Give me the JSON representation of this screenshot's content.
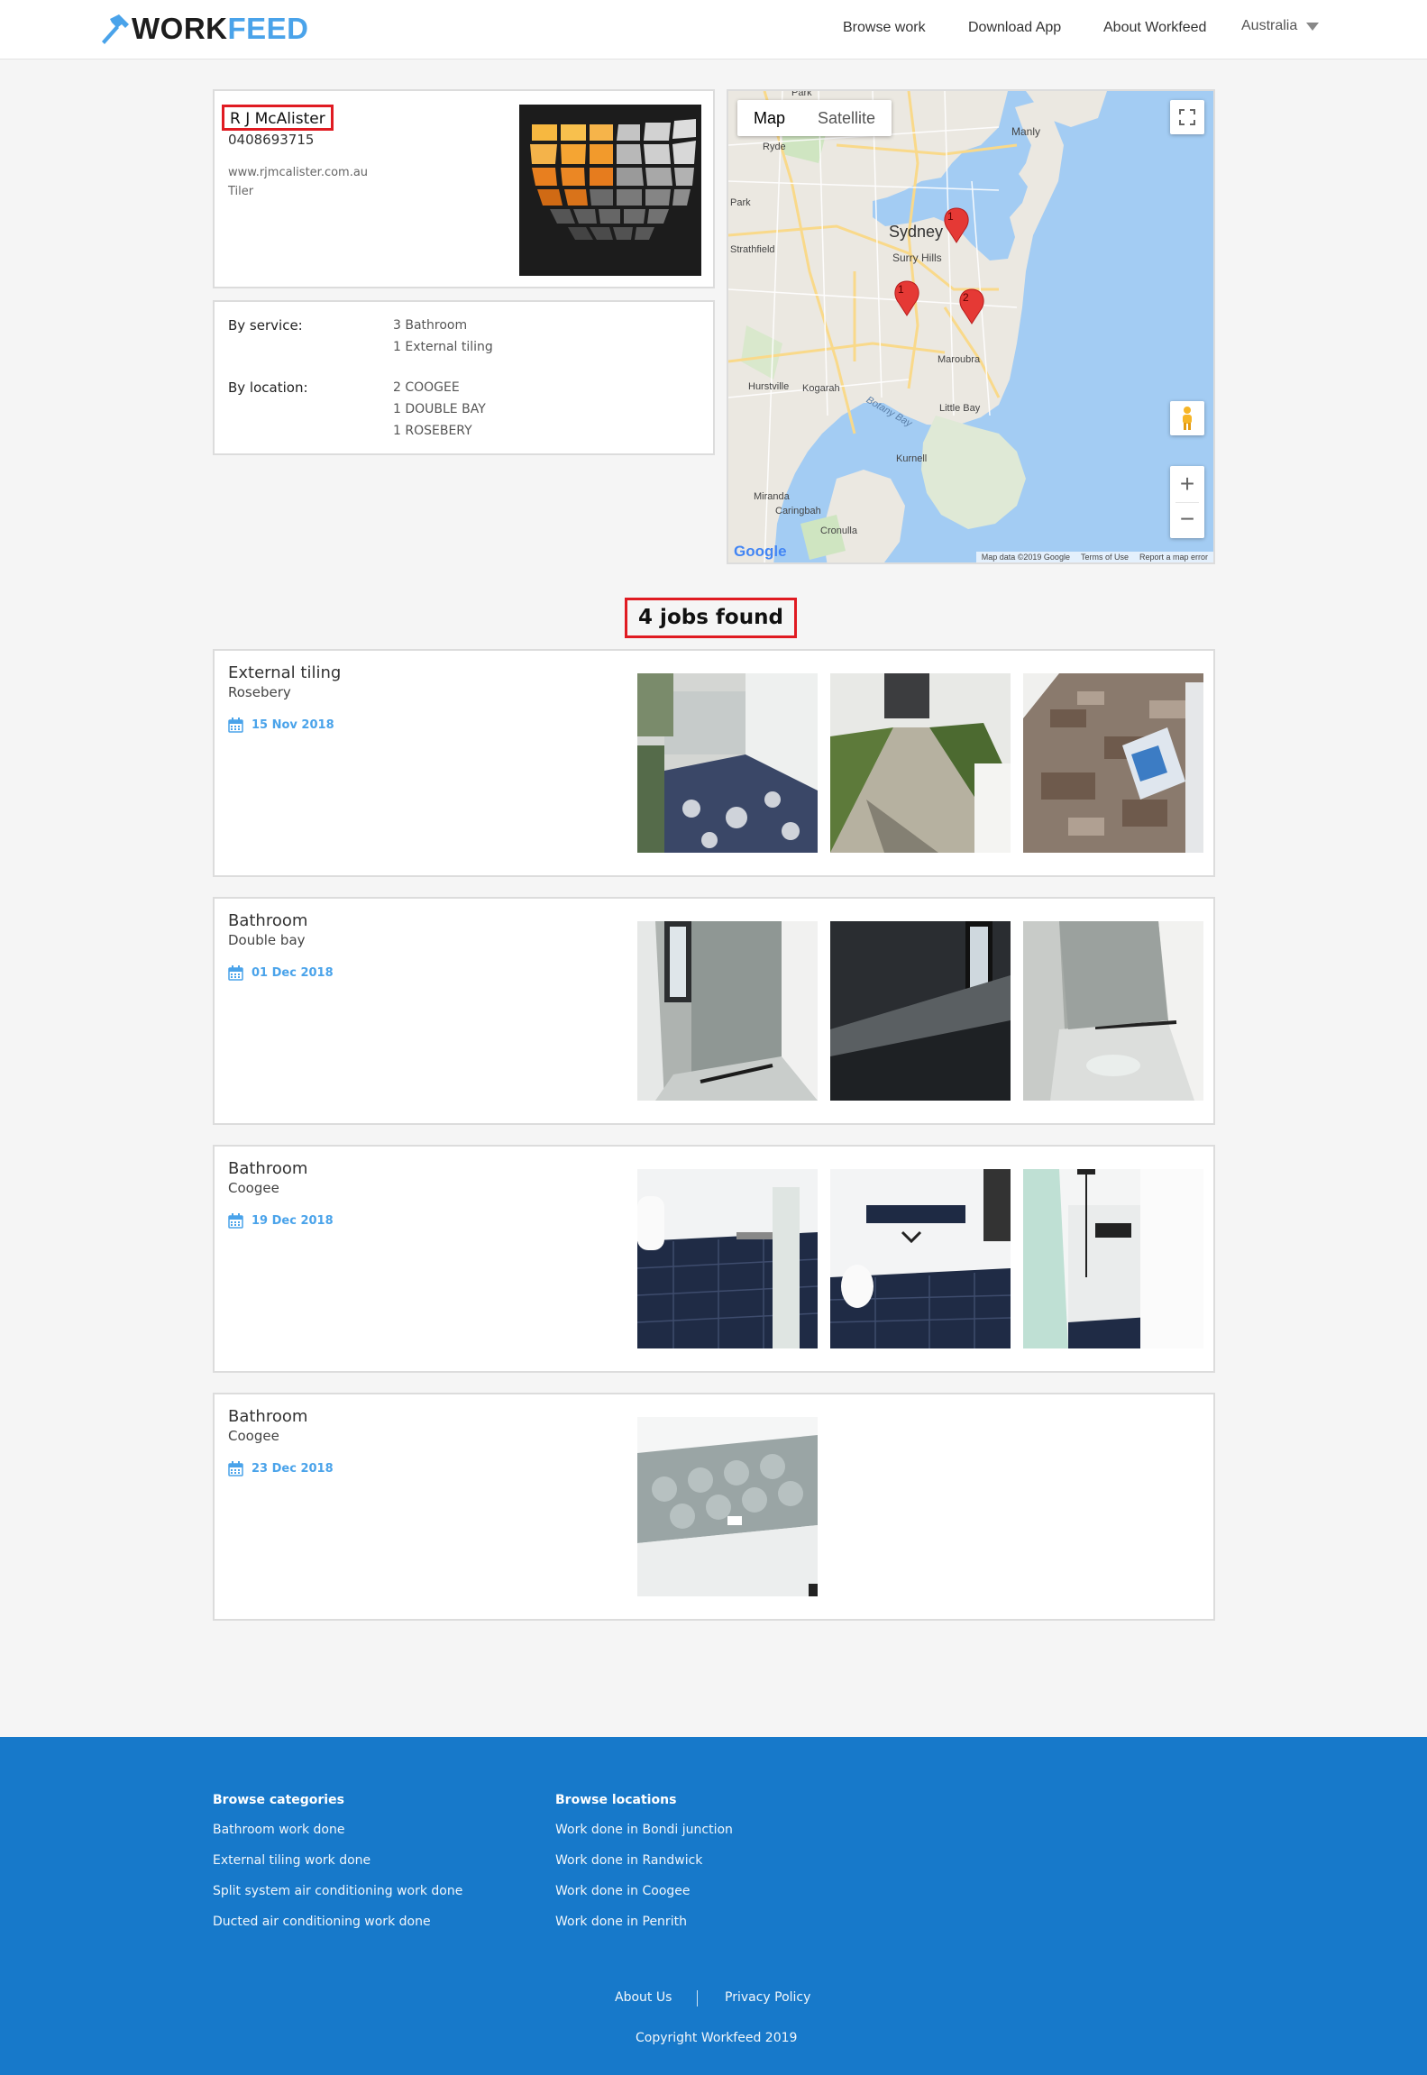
{
  "header": {
    "logo_work": "WORK",
    "logo_feed": "FEED",
    "nav": [
      "Browse work",
      "Download App",
      "About Workfeed"
    ],
    "country": "Australia"
  },
  "profile": {
    "name": "R J McAlister",
    "phone": "0408693715",
    "website": "www.rjmcalister.com.au",
    "trade": "Tiler"
  },
  "summary": {
    "service_label": "By service:",
    "services": [
      "3 Bathroom",
      "1 External tiling"
    ],
    "location_label": "By location:",
    "locations": [
      "2 COOGEE",
      "1 DOUBLE BAY",
      "1 ROSEBERY"
    ]
  },
  "map": {
    "tab_map": "Map",
    "tab_satellite": "Satellite",
    "places": [
      "Sydney",
      "Surry Hills",
      "Manly",
      "Ryde",
      "Strathfield",
      "Maroubra",
      "Hurstville",
      "Kogarah",
      "Little Bay",
      "Kurnell",
      "Miranda",
      "Caringbah",
      "Cronulla",
      "Botany Bay",
      "Park",
      "Park"
    ],
    "markers": [
      "1",
      "1",
      "2"
    ],
    "google": "Google",
    "attribution": [
      "Map data ©2019 Google",
      "Terms of Use",
      "Report a map error"
    ]
  },
  "jobs_heading": "4 jobs found",
  "jobs": [
    {
      "title": "External tiling",
      "location": "Rosebery",
      "date": "15 Nov 2018",
      "photo_count": 3
    },
    {
      "title": "Bathroom",
      "location": "Double bay",
      "date": "01 Dec 2018",
      "photo_count": 3
    },
    {
      "title": "Bathroom",
      "location": "Coogee",
      "date": "19 Dec 2018",
      "photo_count": 3
    },
    {
      "title": "Bathroom",
      "location": "Coogee",
      "date": "23 Dec 2018",
      "photo_count": 1
    }
  ],
  "footer": {
    "categories_heading": "Browse categories",
    "categories": [
      "Bathroom work done",
      "External tiling work done",
      "Split system air conditioning work done",
      "Ducted air conditioning work done"
    ],
    "locations_heading": "Browse locations",
    "locations": [
      "Work done in Bondi junction",
      "Work done in Randwick",
      "Work done in Coogee",
      "Work done in Penrith"
    ],
    "about": "About Us",
    "separator": "|",
    "privacy": "Privacy Policy",
    "copyright": "Copyright Workfeed 2019"
  },
  "colors": {
    "accent": "#4aa3ea",
    "footer_bg": "#1779ca",
    "highlight": "#e01b22",
    "marker": "#e53935"
  }
}
